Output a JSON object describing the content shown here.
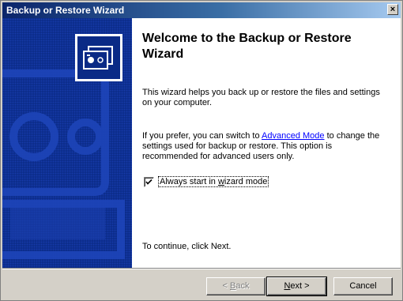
{
  "window": {
    "title": "Backup or Restore Wizard",
    "close_glyph": "×"
  },
  "banner": {
    "icon": "backup-tape-icon"
  },
  "main": {
    "heading": "Welcome to the Backup or Restore Wizard",
    "intro": "This wizard helps you back up or restore the files and settings on your computer.",
    "switch_prefix": "If you prefer, you can switch to ",
    "advanced_link": "Advanced Mode",
    "switch_suffix": " to change the settings used for backup or restore. This option is recommended for advanced users only.",
    "checkbox_label_pre": "Always start in ",
    "checkbox_label_accel": "w",
    "checkbox_label_post": "izard mode",
    "checkbox_checked": true,
    "continue_text": "To continue, click Next."
  },
  "footer": {
    "back_label_pre": "< ",
    "back_label_accel": "B",
    "back_label_post": "ack",
    "next_label_accel": "N",
    "next_label_post": "ext >",
    "cancel_label": "Cancel"
  },
  "colors": {
    "title_active": "#0a246a",
    "banner_blue": "#0a2a86",
    "link": "#0000ff"
  }
}
